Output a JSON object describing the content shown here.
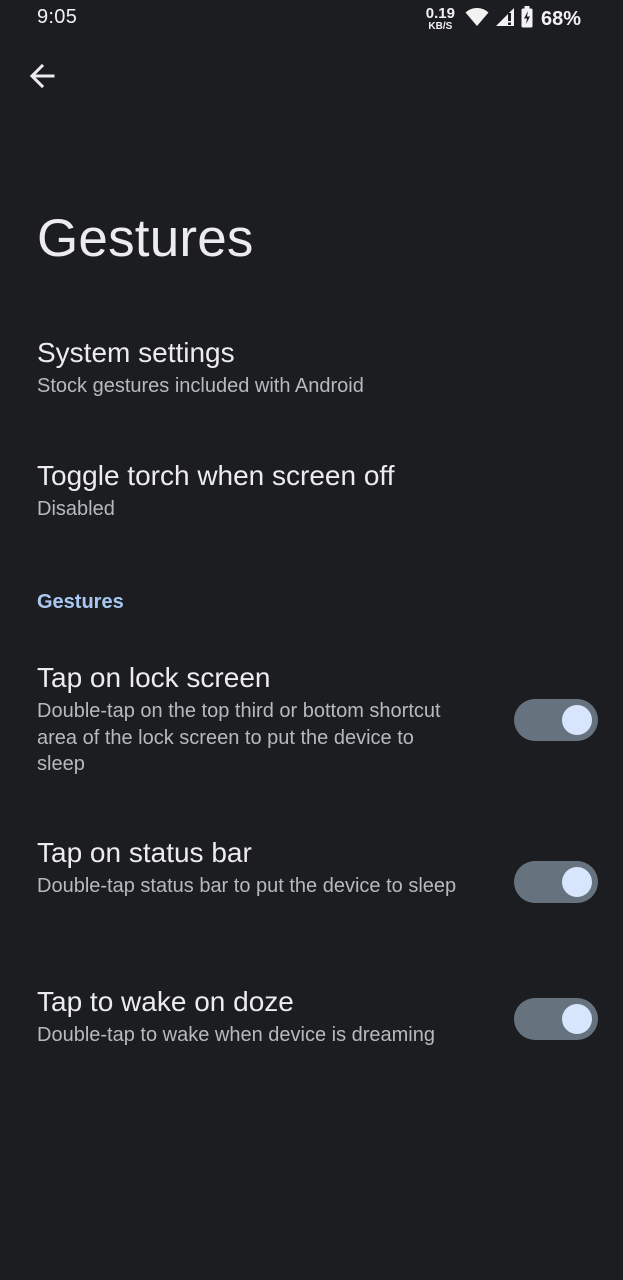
{
  "status_bar": {
    "time": "9:05",
    "net_speed_value": "0.19",
    "net_speed_unit": "KB/S",
    "battery_percent": "68%",
    "icons": [
      "wifi-icon",
      "cell-signal-icon",
      "battery-charging-icon"
    ]
  },
  "header": {
    "back_icon": "back-arrow-icon",
    "title": "Gestures"
  },
  "items": [
    {
      "title": "System settings",
      "summary": "Stock gestures included with Android"
    },
    {
      "title": "Toggle torch when screen off",
      "summary": "Disabled"
    }
  ],
  "section": {
    "header": "Gestures",
    "switches": [
      {
        "title": "Tap on lock screen",
        "summary": "Double-tap on the top third or bottom shortcut area of the lock screen to put the device to sleep",
        "enabled": true
      },
      {
        "title": "Tap on status bar",
        "summary": "Double-tap status bar to put the device to sleep",
        "enabled": true
      },
      {
        "title": "Tap to wake on doze",
        "summary": "Double-tap to wake when device is dreaming",
        "enabled": true
      }
    ]
  },
  "colors": {
    "background": "#1c1d20",
    "accent": "#a8c8f2",
    "switch_track": "#66737f",
    "switch_thumb": "#d7e6fc"
  }
}
